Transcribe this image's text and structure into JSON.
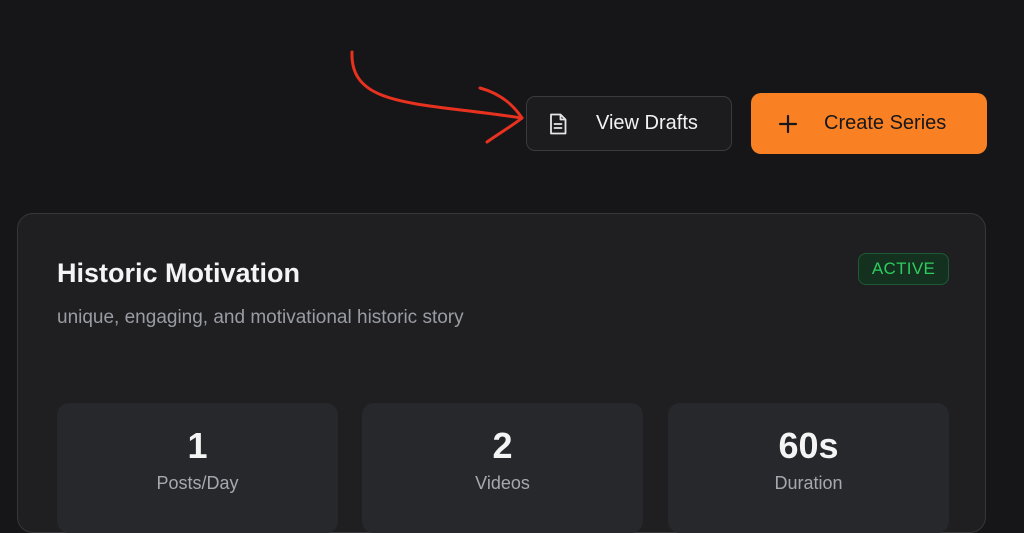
{
  "toolbar": {
    "view_drafts_label": "View Drafts",
    "view_drafts_icon": "document-icon",
    "create_series_label": "Create Series",
    "create_series_icon": "plus-icon"
  },
  "series_card": {
    "title": "Historic Motivation",
    "description": "unique, engaging, and motivational historic story",
    "status": "ACTIVE",
    "stats": [
      {
        "value": "1",
        "label": "Posts/Day"
      },
      {
        "value": "2",
        "label": "Videos"
      },
      {
        "value": "60s",
        "label": "Duration"
      }
    ]
  },
  "colors": {
    "background": "#161618",
    "accent": "#f98123",
    "status_active": "#2ecc5e",
    "annotation": "#e8321f"
  }
}
